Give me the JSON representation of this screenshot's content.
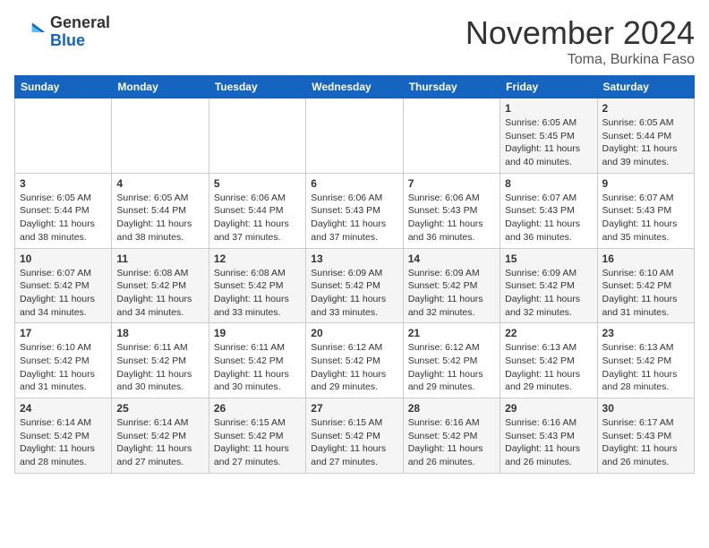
{
  "logo": {
    "general": "General",
    "blue": "Blue"
  },
  "title": "November 2024",
  "location": "Toma, Burkina Faso",
  "days_of_week": [
    "Sunday",
    "Monday",
    "Tuesday",
    "Wednesday",
    "Thursday",
    "Friday",
    "Saturday"
  ],
  "weeks": [
    [
      {
        "day": "",
        "info": ""
      },
      {
        "day": "",
        "info": ""
      },
      {
        "day": "",
        "info": ""
      },
      {
        "day": "",
        "info": ""
      },
      {
        "day": "",
        "info": ""
      },
      {
        "day": "1",
        "info": "Sunrise: 6:05 AM\nSunset: 5:45 PM\nDaylight: 11 hours and 40 minutes."
      },
      {
        "day": "2",
        "info": "Sunrise: 6:05 AM\nSunset: 5:44 PM\nDaylight: 11 hours and 39 minutes."
      }
    ],
    [
      {
        "day": "3",
        "info": "Sunrise: 6:05 AM\nSunset: 5:44 PM\nDaylight: 11 hours and 38 minutes."
      },
      {
        "day": "4",
        "info": "Sunrise: 6:05 AM\nSunset: 5:44 PM\nDaylight: 11 hours and 38 minutes."
      },
      {
        "day": "5",
        "info": "Sunrise: 6:06 AM\nSunset: 5:44 PM\nDaylight: 11 hours and 37 minutes."
      },
      {
        "day": "6",
        "info": "Sunrise: 6:06 AM\nSunset: 5:43 PM\nDaylight: 11 hours and 37 minutes."
      },
      {
        "day": "7",
        "info": "Sunrise: 6:06 AM\nSunset: 5:43 PM\nDaylight: 11 hours and 36 minutes."
      },
      {
        "day": "8",
        "info": "Sunrise: 6:07 AM\nSunset: 5:43 PM\nDaylight: 11 hours and 36 minutes."
      },
      {
        "day": "9",
        "info": "Sunrise: 6:07 AM\nSunset: 5:43 PM\nDaylight: 11 hours and 35 minutes."
      }
    ],
    [
      {
        "day": "10",
        "info": "Sunrise: 6:07 AM\nSunset: 5:42 PM\nDaylight: 11 hours and 34 minutes."
      },
      {
        "day": "11",
        "info": "Sunrise: 6:08 AM\nSunset: 5:42 PM\nDaylight: 11 hours and 34 minutes."
      },
      {
        "day": "12",
        "info": "Sunrise: 6:08 AM\nSunset: 5:42 PM\nDaylight: 11 hours and 33 minutes."
      },
      {
        "day": "13",
        "info": "Sunrise: 6:09 AM\nSunset: 5:42 PM\nDaylight: 11 hours and 33 minutes."
      },
      {
        "day": "14",
        "info": "Sunrise: 6:09 AM\nSunset: 5:42 PM\nDaylight: 11 hours and 32 minutes."
      },
      {
        "day": "15",
        "info": "Sunrise: 6:09 AM\nSunset: 5:42 PM\nDaylight: 11 hours and 32 minutes."
      },
      {
        "day": "16",
        "info": "Sunrise: 6:10 AM\nSunset: 5:42 PM\nDaylight: 11 hours and 31 minutes."
      }
    ],
    [
      {
        "day": "17",
        "info": "Sunrise: 6:10 AM\nSunset: 5:42 PM\nDaylight: 11 hours and 31 minutes."
      },
      {
        "day": "18",
        "info": "Sunrise: 6:11 AM\nSunset: 5:42 PM\nDaylight: 11 hours and 30 minutes."
      },
      {
        "day": "19",
        "info": "Sunrise: 6:11 AM\nSunset: 5:42 PM\nDaylight: 11 hours and 30 minutes."
      },
      {
        "day": "20",
        "info": "Sunrise: 6:12 AM\nSunset: 5:42 PM\nDaylight: 11 hours and 29 minutes."
      },
      {
        "day": "21",
        "info": "Sunrise: 6:12 AM\nSunset: 5:42 PM\nDaylight: 11 hours and 29 minutes."
      },
      {
        "day": "22",
        "info": "Sunrise: 6:13 AM\nSunset: 5:42 PM\nDaylight: 11 hours and 29 minutes."
      },
      {
        "day": "23",
        "info": "Sunrise: 6:13 AM\nSunset: 5:42 PM\nDaylight: 11 hours and 28 minutes."
      }
    ],
    [
      {
        "day": "24",
        "info": "Sunrise: 6:14 AM\nSunset: 5:42 PM\nDaylight: 11 hours and 28 minutes."
      },
      {
        "day": "25",
        "info": "Sunrise: 6:14 AM\nSunset: 5:42 PM\nDaylight: 11 hours and 27 minutes."
      },
      {
        "day": "26",
        "info": "Sunrise: 6:15 AM\nSunset: 5:42 PM\nDaylight: 11 hours and 27 minutes."
      },
      {
        "day": "27",
        "info": "Sunrise: 6:15 AM\nSunset: 5:42 PM\nDaylight: 11 hours and 27 minutes."
      },
      {
        "day": "28",
        "info": "Sunrise: 6:16 AM\nSunset: 5:42 PM\nDaylight: 11 hours and 26 minutes."
      },
      {
        "day": "29",
        "info": "Sunrise: 6:16 AM\nSunset: 5:43 PM\nDaylight: 11 hours and 26 minutes."
      },
      {
        "day": "30",
        "info": "Sunrise: 6:17 AM\nSunset: 5:43 PM\nDaylight: 11 hours and 26 minutes."
      }
    ]
  ]
}
